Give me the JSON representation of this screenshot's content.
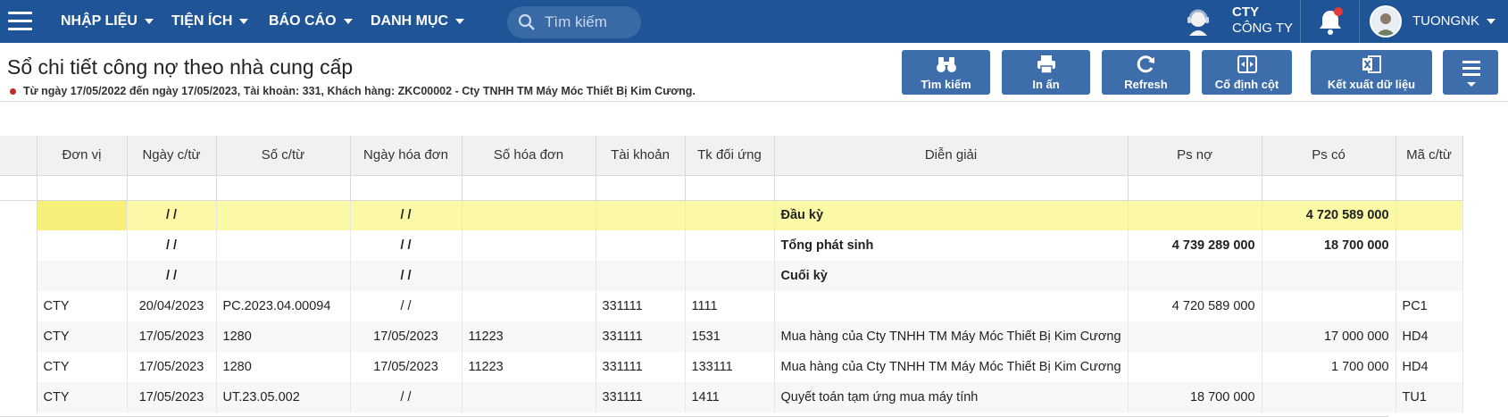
{
  "nav": {
    "menus": [
      "NHẬP LIỆU",
      "TIỆN ÍCH",
      "BÁO CÁO",
      "DANH MỤC"
    ],
    "search_placeholder": "Tìm kiếm",
    "company_code": "CTY",
    "company_name": "CÔNG TY",
    "username": "TUONGNK"
  },
  "page": {
    "title": "Sổ chi tiết công nợ theo nhà cung cấp",
    "subtitle": "Từ ngày 17/05/2022 đến ngày 17/05/2023, Tài khoản: 331, Khách hàng: ZKC00002 - Cty TNHH TM Máy Móc Thiết Bị Kim Cương."
  },
  "toolbar": {
    "search": "Tìm kiếm",
    "print": "In ấn",
    "refresh": "Refresh",
    "pin_columns": "Cố định cột",
    "export": "Kết xuất dữ liệu"
  },
  "grid": {
    "columns": [
      "Đơn vị",
      "Ngày c/từ",
      "Số c/từ",
      "Ngày hóa đơn",
      "Số hóa đơn",
      "Tài khoản",
      "Tk đối ứng",
      "Diễn giải",
      "Ps nợ",
      "Ps có",
      "Mã c/từ"
    ],
    "rows": [
      [
        "",
        "/ /",
        "",
        "/ /",
        "",
        "",
        "",
        "Đầu kỳ",
        "",
        "4 720 589 000",
        ""
      ],
      [
        "",
        "/ /",
        "",
        "/ /",
        "",
        "",
        "",
        "Tổng phát sinh",
        "4 739 289 000",
        "18 700 000",
        ""
      ],
      [
        "",
        "/ /",
        "",
        "/ /",
        "",
        "",
        "",
        "Cuối kỳ",
        "",
        "",
        ""
      ],
      [
        "CTY",
        "20/04/2023",
        "PC.2023.04.00094",
        "/ /",
        "",
        "331111",
        "1111",
        "",
        "4 720 589 000",
        "",
        "PC1"
      ],
      [
        "CTY",
        "17/05/2023",
        "1280",
        "17/05/2023",
        "11223",
        "331111",
        "1531",
        "Mua hàng của Cty TNHH TM Máy Móc Thiết Bị Kim Cương",
        "",
        "17 000 000",
        "HD4"
      ],
      [
        "CTY",
        "17/05/2023",
        "1280",
        "17/05/2023",
        "11223",
        "331111",
        "133111",
        "Mua hàng của Cty TNHH TM Máy Móc Thiết Bị Kim Cương",
        "",
        "1 700 000",
        "HD4"
      ],
      [
        "CTY",
        "17/05/2023",
        "UT.23.05.002",
        "/ /",
        "",
        "331111",
        "1411",
        "Quyết toán tạm ứng mua máy tính",
        "18 700 000",
        "",
        "TU1"
      ]
    ]
  },
  "colors": {
    "nav_bg": "#1f5496",
    "button_bg": "#3d6eab",
    "highlight_row": "#fbf8a6"
  }
}
